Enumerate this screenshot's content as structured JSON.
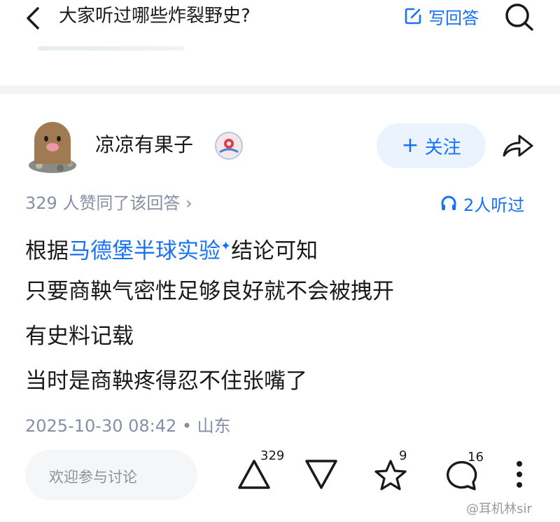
{
  "header": {
    "question_title": "大家听过哪些炸裂野史?",
    "write_answer_label": "写回答"
  },
  "author": {
    "name": "凉凉有果子",
    "follow_label": "关注"
  },
  "meta": {
    "agree_text": "329 人赞同了该回答 ›",
    "listen_text": "2人听过"
  },
  "answer": {
    "line1_prefix": "根据",
    "line1_link": "马德堡半球实验",
    "line1_spark": "✦",
    "line1_suffix": "结论可知",
    "line2": "只要商鞅气密性足够良好就不会被拽开",
    "line3": "有史料记载",
    "line4": "当时是商鞅疼得忍不住张嘴了",
    "timestamp": "2025-10-30 08:42 • 山东"
  },
  "bottom_bar": {
    "comment_placeholder": "欢迎参与讨论",
    "upvote_count": "329",
    "favorite_count": "9",
    "comment_count": "16"
  },
  "watermark": "@耳机林sir",
  "colors": {
    "accent": "#1772f6",
    "follow_bg": "#ebf3ff",
    "muted_text": "#8590a6",
    "divider": "#f3f4f6"
  },
  "icons": [
    "back-icon",
    "edit-icon",
    "search-icon",
    "share-icon",
    "headphone-icon",
    "upvote-icon",
    "downvote-icon",
    "star-icon",
    "comment-icon",
    "more-icon"
  ]
}
